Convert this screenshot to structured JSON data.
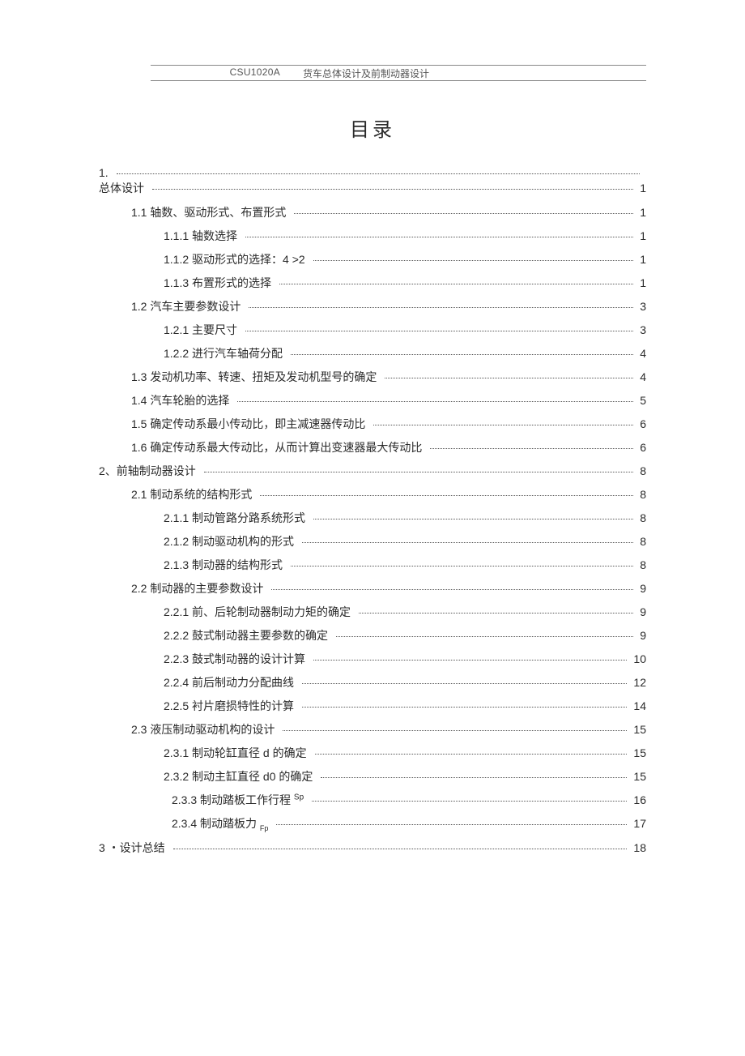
{
  "header": {
    "code": "CSU1020A",
    "title": "货车总体设计及前制动器设计"
  },
  "title": "目录",
  "toc": [
    {
      "level": "l0",
      "label": "1.",
      "page": "",
      "cls": "stack-a"
    },
    {
      "level": "l0",
      "label": "总体设计",
      "page": "1",
      "cls": "stack-b"
    },
    {
      "level": "l1",
      "label": "1.1 轴数、驱动形式、布置形式",
      "page": "1"
    },
    {
      "level": "l2",
      "label": "1.1.1 轴数选择",
      "page": "1"
    },
    {
      "level": "l2",
      "label": "1.1.2 驱动形式的选择：4 >2",
      "page": "1"
    },
    {
      "level": "l2",
      "label": "1.1.3 布置形式的选择",
      "page": "1"
    },
    {
      "level": "l1",
      "label": "1.2 汽车主要参数设计",
      "page": "3"
    },
    {
      "level": "l2",
      "label": "1.2.1 主要尺寸",
      "page": "3"
    },
    {
      "level": "l2",
      "label": "1.2.2 进行汽车轴荷分配",
      "page": "4"
    },
    {
      "level": "l1",
      "label": "1.3 发动机功率、转速、扭矩及发动机型号的确定",
      "page": "4"
    },
    {
      "level": "l1",
      "label": "1.4 汽车轮胎的选择",
      "page": "5"
    },
    {
      "level": "l1",
      "label": "1.5 确定传动系最小传动比，即主减速器传动比",
      "page": "6"
    },
    {
      "level": "l1",
      "label": "1.6 确定传动系最大传动比，从而计算出变速器最大传动比",
      "page": "6"
    },
    {
      "level": "l0",
      "label": "2、前轴制动器设计",
      "page": "8"
    },
    {
      "level": "l1",
      "label": "2.1 制动系统的结构形式",
      "page": "8"
    },
    {
      "level": "l2",
      "label": "2.1.1 制动管路分路系统形式",
      "page": "8"
    },
    {
      "level": "l2",
      "label": "2.1.2 制动驱动机构的形式",
      "page": "8"
    },
    {
      "level": "l2",
      "label": "2.1.3 制动器的结构形式",
      "page": "8"
    },
    {
      "level": "l1",
      "label": "2.2 制动器的主要参数设计",
      "page": "9"
    },
    {
      "level": "l2",
      "label": "2.2.1 前、后轮制动器制动力矩的确定",
      "page": "9"
    },
    {
      "level": "l2",
      "label": "2.2.2 鼓式制动器主要参数的确定",
      "page": "9"
    },
    {
      "level": "l2",
      "label": "2.2.3 鼓式制动器的设计计算",
      "page": "10"
    },
    {
      "level": "l2",
      "label": "2.2.4 前后制动力分配曲线",
      "page": "12"
    },
    {
      "level": "l2",
      "label": "2.2.5 衬片磨损特性的计算",
      "page": "14"
    },
    {
      "level": "l1",
      "label": "2.3 液压制动驱动机构的设计",
      "page": "15"
    },
    {
      "level": "l2",
      "label": "2.3.1 制动轮缸直径 d 的确定",
      "page": "15"
    },
    {
      "level": "l2",
      "label": "2.3.2 制动主缸直径 d0 的确定",
      "page": "15"
    },
    {
      "level": "l2b",
      "label_pre": "2.3.3 制动踏板工作行程 ",
      "label_sup": "Sp",
      "page": "16",
      "special": "sup"
    },
    {
      "level": "l2b",
      "label_pre": "2.3.4 制动踏板力 ",
      "label_sub": "Fp",
      "page": "17",
      "special": "sub"
    },
    {
      "level": "l0",
      "label": "3 ・设计总结",
      "page": "18"
    }
  ]
}
